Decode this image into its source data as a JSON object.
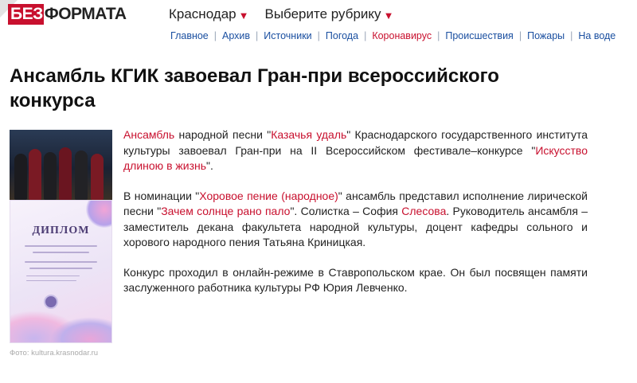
{
  "logo": {
    "prefix": "БЕЗ",
    "main": "ФОРМАТА"
  },
  "top_menu": {
    "city": "Краснодар",
    "rubric": "Выберите рубрику"
  },
  "nav": [
    {
      "label": "Главное"
    },
    {
      "label": "Архив"
    },
    {
      "label": "Источники"
    },
    {
      "label": "Погода"
    },
    {
      "label": "Коронавирус"
    },
    {
      "label": "Происшествия"
    },
    {
      "label": "Пожары"
    },
    {
      "label": "На воде"
    }
  ],
  "article": {
    "title": "Ансамбль КГИК завоевал Гран-при всероссийского конкурса",
    "photo_caption_label": "Фото:",
    "photo_caption_source": "kultura.krasnodar.ru",
    "diploma_word": "ДИПЛОМ",
    "p1": {
      "link1": "Ансамбль",
      "t1": " народной песни \"",
      "link2": "Казачья удаль",
      "t2": "\" Краснодарского государственного института культуры завоевал Гран-при на II Всероссийском фестивале–конкурсе \"",
      "link3": "Искусство длиною в жизнь",
      "t3": "\"."
    },
    "p2": {
      "t1": "В номинации \"",
      "link1": "Хоровое пение (народное)",
      "t2": "\" ансамбль представил исполнение лирической песни \"",
      "link2": "Зачем солнце рано пало",
      "t3": "\". Солистка – София ",
      "link3": "Слесова",
      "t4": ". Руководитель ансамбля – заместитель декана факультета народной культуры, доцент кафедры сольного и хорового народного пения Татьяна Криницкая."
    },
    "p3": "Конкурс проходил в онлайн-режиме в Ставропольском крае. Он был посвящен памяти заслуженного работника культуры РФ Юрия Левченко."
  },
  "colors": {
    "accent": "#c8102e",
    "nav_link": "#1a4fa0"
  },
  "icons": {
    "dropdown": "caret-down-icon"
  }
}
